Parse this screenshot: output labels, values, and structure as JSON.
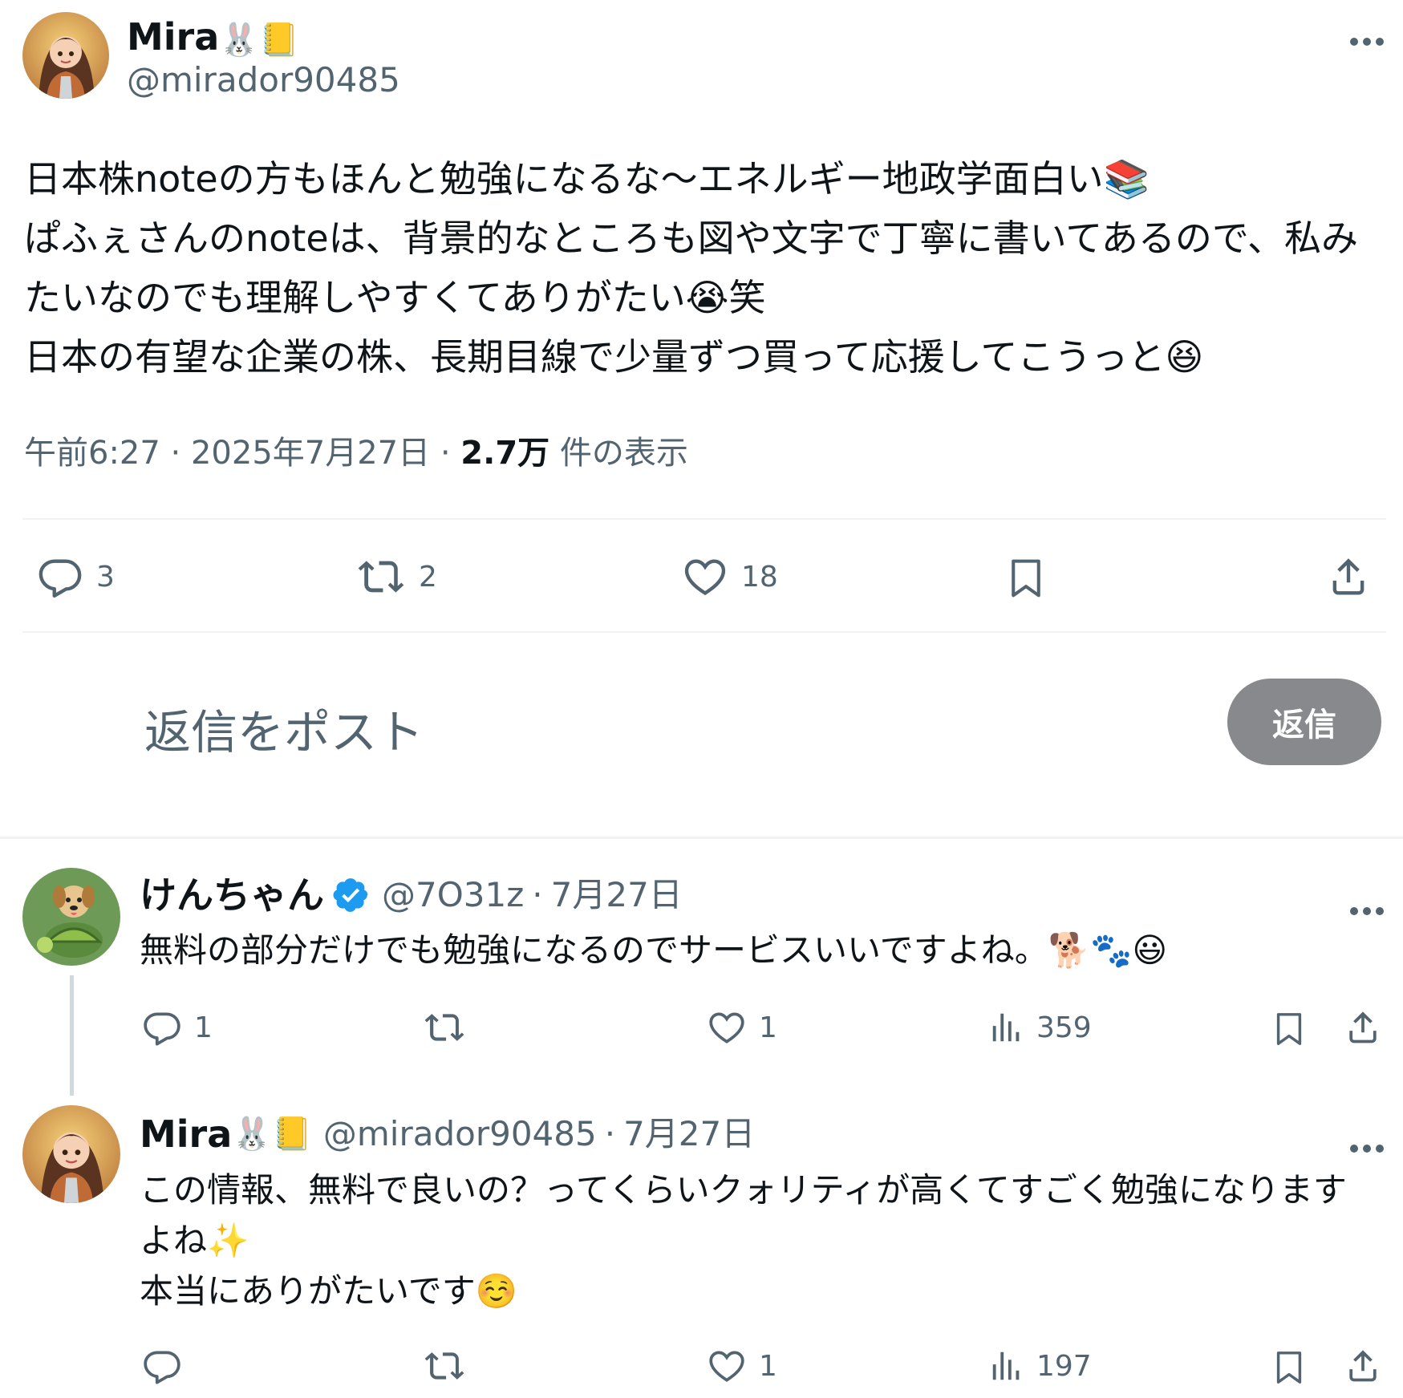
{
  "main_tweet": {
    "author_name": "Mira",
    "author_emojis": "🐰📒",
    "author_handle": "@mirador90485",
    "text": "日本株noteの方もほんと勉強になるな〜エネルギー地政学面白い📚\nぱふぇさんのnoteは、背景的なところも図や文字で丁寧に書いてあるので、私みたいなのでも理解しやすくてありがたい😭笑\n日本の有望な企業の株、長期目線で少量ずつ買って応援してこうっと😆",
    "time": "午前6:27",
    "separator": "·",
    "date": "2025年7月27日",
    "views_count": "2.7万",
    "views_label": "件の表示",
    "stats": {
      "replies": "3",
      "reposts": "2",
      "likes": "18"
    }
  },
  "compose": {
    "placeholder": "返信をポスト",
    "button_label": "返信"
  },
  "replies": [
    {
      "author_name": "けんちゃん",
      "author_handle": "@7O31z",
      "separator": "·",
      "date": "7月27日",
      "text": "無料の部分だけでも勉強になるのでサービスいいですよね。🐕🐾😃",
      "stats": {
        "replies": "1",
        "reposts": "",
        "likes": "1",
        "views": "359"
      }
    },
    {
      "author_name": "Mira",
      "author_emojis": "🐰📒",
      "author_handle": "@mirador90485",
      "separator": "·",
      "date": "7月27日",
      "text": "この情報、無料で良いの？ってくらいクォリティが高くてすごく勉強になりますよね✨\n本当にありがたいです☺️",
      "stats": {
        "replies": "",
        "reposts": "",
        "likes": "1",
        "views": "197"
      }
    }
  ],
  "icons": {
    "reply": "reply-icon",
    "repost": "repost-icon",
    "like": "heart-icon",
    "bookmark": "bookmark-icon",
    "share": "share-icon",
    "views": "views-icon",
    "more": "more-icon",
    "verified": "verified-badge-icon"
  },
  "colors": {
    "text": "#0f1419",
    "secondary": "#536471",
    "divider": "#eff3f4",
    "verified": "#1d9bf0",
    "reply_button": "#87898c"
  }
}
